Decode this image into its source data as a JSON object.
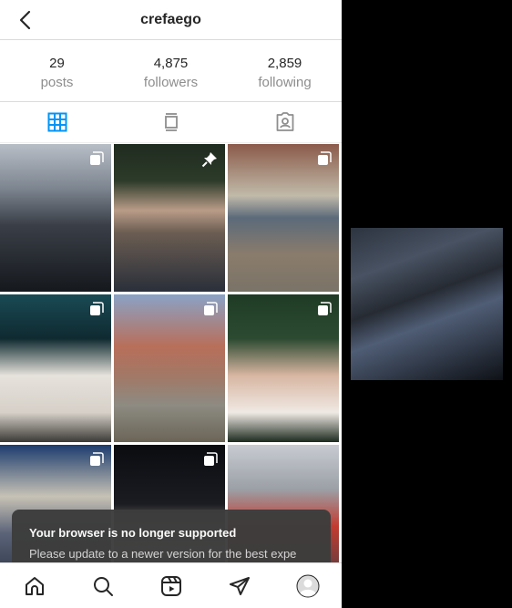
{
  "header": {
    "username": "crefaego"
  },
  "stats": [
    {
      "count": "29",
      "label": "posts"
    },
    {
      "count": "4,875",
      "label": "followers"
    },
    {
      "count": "2,859",
      "label": "following"
    }
  ],
  "tabs": [
    {
      "icon": "grid-icon",
      "active": true
    },
    {
      "icon": "feed-icon",
      "active": false
    },
    {
      "icon": "tagged-icon",
      "active": false
    }
  ],
  "toast": {
    "title": "Your browser is no longer supported",
    "message": "Please update to a newer version for the best expe"
  },
  "bottom_nav": [
    "home-icon",
    "search-icon",
    "reels-icon",
    "direct-icon",
    "profile-avatar"
  ],
  "colors": {
    "active_tab": "#0095f6",
    "text": "#262626",
    "muted": "#8e8e8e"
  }
}
